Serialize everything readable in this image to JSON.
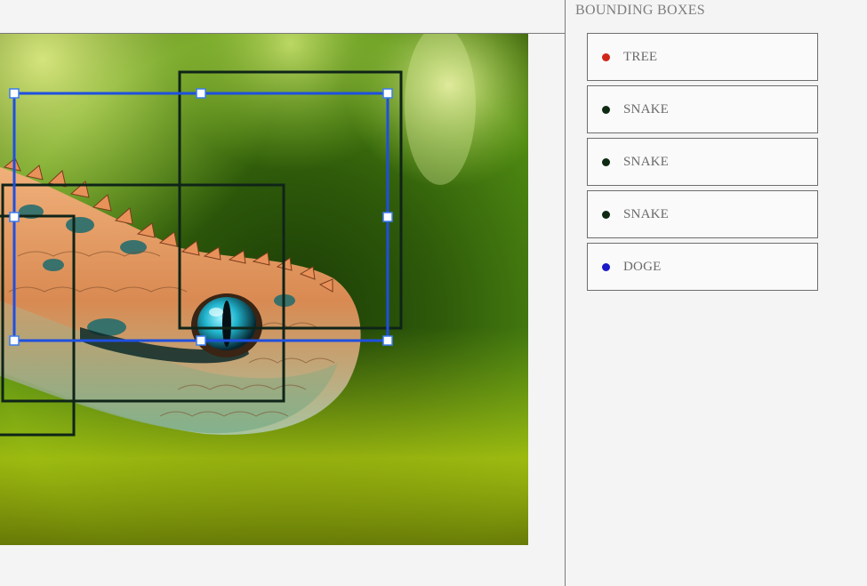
{
  "panel": {
    "title": "BOUNDING BOXES",
    "items": [
      {
        "label": "TREE",
        "color": "#d0271b"
      },
      {
        "label": "SNAKE",
        "color": "#0f2a12"
      },
      {
        "label": "SNAKE",
        "color": "#0f2a12"
      },
      {
        "label": "SNAKE",
        "color": "#0f2a12"
      },
      {
        "label": "DOGE",
        "color": "#1a1ac8"
      }
    ]
  },
  "canvas": {
    "image_subject": "green bush viper close-up photo",
    "selected_box": "DOGE",
    "selected_color": "#1f4fe0",
    "box_color": "#0f2418"
  }
}
